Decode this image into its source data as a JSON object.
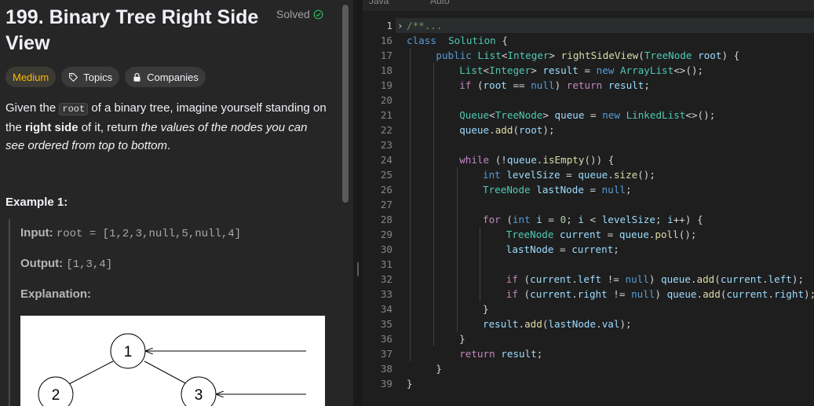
{
  "problem": {
    "title": "199. Binary Tree Right Side View",
    "status": "Solved",
    "tags": [
      "Medium",
      "Topics",
      "Companies"
    ],
    "description": {
      "p1": "Given the ",
      "code": "root",
      "p2": " of a binary tree, imagine yourself standing on the ",
      "bold": "right side",
      "p3": " of it, return ",
      "italic": "the values of the nodes you can see ordered from top to bottom",
      "p4": "."
    },
    "example_title": "Example 1:",
    "example": {
      "input_label": "Input:",
      "input_value": "root = [1,2,3,null,5,null,4]",
      "output_label": "Output:",
      "output_value": "[1,3,4]",
      "explanation_label": "Explanation:"
    },
    "tree_nodes": [
      "1",
      "2",
      "3"
    ]
  },
  "editor": {
    "language": "Java",
    "mode": "Auto",
    "lines": [
      {
        "n": "1",
        "fold": true,
        "tokens": [
          [
            "cm",
            "/**"
          ],
          [
            "cm",
            "..."
          ]
        ]
      },
      {
        "n": "16",
        "tokens": [
          [
            "kw",
            "class"
          ],
          [
            "",
            "  "
          ],
          [
            "ty",
            "Solution"
          ],
          [
            "",
            " {"
          ]
        ]
      },
      {
        "n": "17",
        "tokens": [
          [
            "",
            " "
          ],
          [
            "kw",
            "public"
          ],
          [
            "",
            " "
          ],
          [
            "ty",
            "List"
          ],
          [
            "",
            "<"
          ],
          [
            "ty",
            "Integer"
          ],
          [
            "",
            "> "
          ],
          [
            "fn",
            "rightSideView"
          ],
          [
            "",
            "("
          ],
          [
            "ty",
            "TreeNode"
          ],
          [
            "",
            " "
          ],
          [
            "va",
            "root"
          ],
          [
            "",
            ") {"
          ]
        ]
      },
      {
        "n": "18",
        "tokens": [
          [
            "",
            " "
          ],
          [
            "ty",
            "List"
          ],
          [
            "",
            "<"
          ],
          [
            "ty",
            "Integer"
          ],
          [
            "",
            "> "
          ],
          [
            "va",
            "result"
          ],
          [
            "",
            " = "
          ],
          [
            "kw",
            "new"
          ],
          [
            "",
            " "
          ],
          [
            "ty",
            "ArrayList"
          ],
          [
            "",
            "<>();"
          ]
        ]
      },
      {
        "n": "19",
        "tokens": [
          [
            "",
            " "
          ],
          [
            "ctl",
            "if"
          ],
          [
            "",
            " ("
          ],
          [
            "va",
            "root"
          ],
          [
            "",
            " == "
          ],
          [
            "kw",
            "null"
          ],
          [
            "",
            ") "
          ],
          [
            "ctl",
            "return"
          ],
          [
            "",
            " "
          ],
          [
            "va",
            "result"
          ],
          [
            "",
            ";"
          ]
        ]
      },
      {
        "n": "20",
        "tokens": []
      },
      {
        "n": "21",
        "tokens": [
          [
            "",
            " "
          ],
          [
            "ty",
            "Queue"
          ],
          [
            "",
            "<"
          ],
          [
            "ty",
            "TreeNode"
          ],
          [
            "",
            "> "
          ],
          [
            "va",
            "queue"
          ],
          [
            "",
            " = "
          ],
          [
            "kw",
            "new"
          ],
          [
            "",
            " "
          ],
          [
            "ty",
            "LinkedList"
          ],
          [
            "",
            "<>();"
          ]
        ]
      },
      {
        "n": "22",
        "tokens": [
          [
            "",
            " "
          ],
          [
            "va",
            "queue"
          ],
          [
            "",
            "."
          ],
          [
            "fn",
            "add"
          ],
          [
            "",
            "("
          ],
          [
            "va",
            "root"
          ],
          [
            "",
            ");"
          ]
        ]
      },
      {
        "n": "23",
        "tokens": []
      },
      {
        "n": "24",
        "tokens": [
          [
            "",
            " "
          ],
          [
            "ctl",
            "while"
          ],
          [
            "",
            " (!"
          ],
          [
            "va",
            "queue"
          ],
          [
            "",
            "."
          ],
          [
            "fn",
            "isEmpty"
          ],
          [
            "",
            "()) {"
          ]
        ]
      },
      {
        "n": "25",
        "tokens": [
          [
            "",
            " "
          ],
          [
            "kw",
            "int"
          ],
          [
            "",
            " "
          ],
          [
            "va",
            "levelSize"
          ],
          [
            "",
            " = "
          ],
          [
            "va",
            "queue"
          ],
          [
            "",
            "."
          ],
          [
            "fn",
            "size"
          ],
          [
            "",
            "();"
          ]
        ]
      },
      {
        "n": "26",
        "tokens": [
          [
            "",
            " "
          ],
          [
            "ty",
            "TreeNode"
          ],
          [
            "",
            " "
          ],
          [
            "va",
            "lastNode"
          ],
          [
            "",
            " = "
          ],
          [
            "kw",
            "null"
          ],
          [
            "",
            ";"
          ]
        ]
      },
      {
        "n": "27",
        "tokens": []
      },
      {
        "n": "28",
        "tokens": [
          [
            "",
            " "
          ],
          [
            "ctl",
            "for"
          ],
          [
            "",
            " ("
          ],
          [
            "kw",
            "int"
          ],
          [
            "",
            " "
          ],
          [
            "va",
            "i"
          ],
          [
            "",
            " = "
          ],
          [
            "nu",
            "0"
          ],
          [
            "",
            "; "
          ],
          [
            "va",
            "i"
          ],
          [
            "",
            " < "
          ],
          [
            "va",
            "levelSize"
          ],
          [
            "",
            "; "
          ],
          [
            "va",
            "i"
          ],
          [
            "",
            "++) {"
          ]
        ]
      },
      {
        "n": "29",
        "tokens": [
          [
            "",
            " "
          ],
          [
            "ty",
            "TreeNode"
          ],
          [
            "",
            " "
          ],
          [
            "va",
            "current"
          ],
          [
            "",
            " = "
          ],
          [
            "va",
            "queue"
          ],
          [
            "",
            "."
          ],
          [
            "fn",
            "poll"
          ],
          [
            "",
            "();"
          ]
        ]
      },
      {
        "n": "30",
        "tokens": [
          [
            "",
            " "
          ],
          [
            "va",
            "lastNode"
          ],
          [
            "",
            " = "
          ],
          [
            "va",
            "current"
          ],
          [
            "",
            ";"
          ]
        ]
      },
      {
        "n": "31",
        "tokens": []
      },
      {
        "n": "32",
        "tokens": [
          [
            "",
            " "
          ],
          [
            "ctl",
            "if"
          ],
          [
            "",
            " ("
          ],
          [
            "va",
            "current"
          ],
          [
            "",
            "."
          ],
          [
            "va",
            "left"
          ],
          [
            "",
            " != "
          ],
          [
            "kw",
            "null"
          ],
          [
            "",
            ") "
          ],
          [
            "va",
            "queue"
          ],
          [
            "",
            "."
          ],
          [
            "fn",
            "add"
          ],
          [
            "",
            "("
          ],
          [
            "va",
            "current"
          ],
          [
            "",
            "."
          ],
          [
            "va",
            "left"
          ],
          [
            "",
            ");"
          ]
        ]
      },
      {
        "n": "33",
        "tokens": [
          [
            "",
            " "
          ],
          [
            "ctl",
            "if"
          ],
          [
            "",
            " ("
          ],
          [
            "va",
            "current"
          ],
          [
            "",
            "."
          ],
          [
            "va",
            "right"
          ],
          [
            "",
            " != "
          ],
          [
            "kw",
            "null"
          ],
          [
            "",
            ") "
          ],
          [
            "va",
            "queue"
          ],
          [
            "",
            "."
          ],
          [
            "fn",
            "add"
          ],
          [
            "",
            "("
          ],
          [
            "va",
            "current"
          ],
          [
            "",
            "."
          ],
          [
            "va",
            "right"
          ],
          [
            "",
            ");"
          ]
        ]
      },
      {
        "n": "34",
        "tokens": [
          [
            "",
            " }"
          ]
        ]
      },
      {
        "n": "35",
        "tokens": [
          [
            "",
            " "
          ],
          [
            "va",
            "result"
          ],
          [
            "",
            "."
          ],
          [
            "fn",
            "add"
          ],
          [
            "",
            "("
          ],
          [
            "va",
            "lastNode"
          ],
          [
            "",
            "."
          ],
          [
            "va",
            "val"
          ],
          [
            "",
            ");"
          ]
        ]
      },
      {
        "n": "36",
        "tokens": [
          [
            "",
            " }"
          ]
        ]
      },
      {
        "n": "37",
        "tokens": [
          [
            "",
            " "
          ],
          [
            "ctl",
            "return"
          ],
          [
            "",
            " "
          ],
          [
            "va",
            "result"
          ],
          [
            "",
            ";"
          ]
        ]
      },
      {
        "n": "38",
        "tokens": [
          [
            "",
            " }"
          ]
        ]
      },
      {
        "n": "39",
        "tokens": [
          [
            "",
            "}"
          ]
        ]
      }
    ]
  },
  "colors": {
    "accent_medium": "#ffb800",
    "solved_green": "#2cbb5d"
  }
}
